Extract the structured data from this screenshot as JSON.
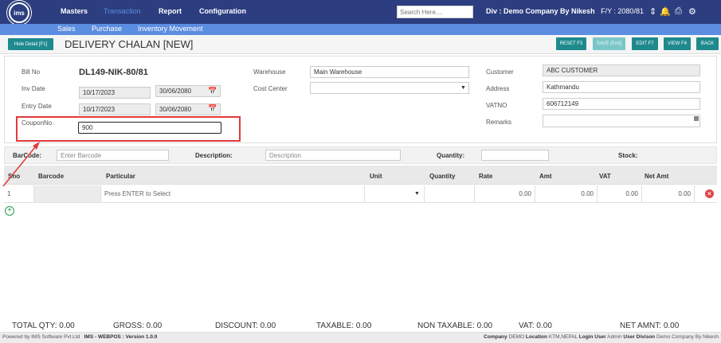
{
  "nav": {
    "logo_text": "ims",
    "items": [
      "Masters",
      "Transaction",
      "Report",
      "Configuration"
    ],
    "search_placeholder": "Search Here....",
    "div_label": "Div :",
    "div_value": "Demo Company By Nikesh",
    "fy_label": "F/Y : 2080/81"
  },
  "subnav": {
    "items": [
      "Sales",
      "Purchase",
      "Inventory Movement"
    ]
  },
  "titlebar": {
    "hide_detail": "Hide Detail [F1]",
    "title": "DELIVERY CHALAN [NEW]",
    "buttons": [
      "RESET F3",
      "SAVE [End]",
      "EDIT F7",
      "VIEW F4",
      "BACK"
    ]
  },
  "form": {
    "bill_no_label": "Bill No",
    "bill_no": "DL149-NIK-80/81",
    "inv_date_label": "Inv Date",
    "inv_date_ad": "10/17/2023",
    "inv_date_bs": "30/06/2080",
    "entry_date_label": "Entry Date",
    "entry_date_ad": "10/17/2023",
    "entry_date_bs": "30/06/2080",
    "coupon_label": "CouponNo.",
    "coupon_value": "900",
    "warehouse_label": "Warehouse",
    "warehouse_value": "Main Warehouse",
    "cost_center_label": "Cost Center",
    "cost_center_value": "",
    "customer_label": "Customer",
    "customer_value": "ABC CUSTOMER",
    "address_label": "Address",
    "address_value": "Kathmandu",
    "vatno_label": "VATNO",
    "vatno_value": "606712149",
    "remarks_label": "Remarks",
    "remarks_value": ""
  },
  "barcode_row": {
    "barcode_label": "BarCode:",
    "barcode_placeholder": "Enter Barcode",
    "description_label": "Description:",
    "description_placeholder": "Description",
    "quantity_label": "Quantity:",
    "stock_label": "Stock:"
  },
  "table": {
    "headers": [
      "Sno",
      "Barcode",
      "Particular",
      "Unit",
      "Quantity",
      "Rate",
      "Amt",
      "VAT",
      "Net Amt"
    ],
    "rows": [
      {
        "sno": "1",
        "barcode": "",
        "particular": "Press ENTER to Select",
        "unit": "",
        "quantity": "",
        "rate": "0.00",
        "amt": "0.00",
        "vat": "0.00",
        "net_amt": "0.00"
      }
    ]
  },
  "totals": {
    "total_qty": "TOTAL QTY: 0.00",
    "gross": "GROSS: 0.00",
    "discount": "DISCOUNT: 0.00",
    "taxable": "TAXABLE: 0.00",
    "non_taxable": "NON TAXABLE: 0.00",
    "vat": "VAT: 0.00",
    "net_amnt": "NET AMNT: 0.00"
  },
  "footer": {
    "powered_by": "Powered by IMS Software Pvt.Ltd",
    "version": "IMS - WEBPOS : Version 1.0.0",
    "company_label": "Company",
    "company_value": "DEMO",
    "location_label": "Location",
    "location_value": "KTM,NEPAL",
    "login_label": "Login User",
    "login_value": "Admin",
    "division_label": "User Divison",
    "division_value": "Demo Company By Nikesh"
  },
  "colors": {
    "nav": "#2c3e80",
    "subnav": "#5b8de0",
    "teal": "#1e8a8e",
    "highlight": "#e23a3a"
  }
}
